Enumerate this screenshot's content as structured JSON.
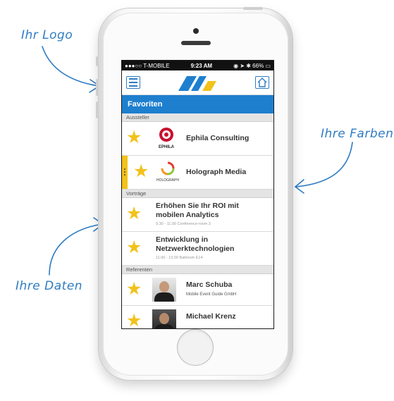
{
  "annotations": {
    "logo": "Ihr Logo",
    "colors": "Ihre Farben",
    "data": "Ihre Daten"
  },
  "status_bar": {
    "carrier": "●●●○○ T-MOBILE ",
    "time": "9:23 AM",
    "battery": "◉ ➤ ✱ 66% ▭"
  },
  "app": {
    "title": "Favoriten",
    "accent_color": "#1e7fcf",
    "star_color": "#f2c21a",
    "menu_icon": "hamburger-icon",
    "home_icon": "home-icon"
  },
  "sections": {
    "exhibitors": {
      "header": "Aussteller",
      "items": [
        {
          "name": "Ephila Consulting",
          "logo_text": "EPHILA"
        },
        {
          "name": "Holograph Media",
          "logo_text": "HOLOGRAPH"
        }
      ]
    },
    "talks": {
      "header": "Vorträge",
      "items": [
        {
          "title_line1": "Erhöhen Sie Ihr ROI mit",
          "title_line2": "mobilen Analytics",
          "details": "9.30 - 11.00 Conference-room 3"
        },
        {
          "title_line1": "Entwicklung in",
          "title_line2": "Netzwerktechnologien",
          "details": "11.00 - 13.00 Ballroom E14"
        }
      ]
    },
    "speakers": {
      "header": "Referenten",
      "items": [
        {
          "name": "Marc Schuba",
          "company": "Mobile Event Guide GmbH"
        },
        {
          "name": "Michael Krenz",
          "company": ""
        }
      ]
    }
  }
}
